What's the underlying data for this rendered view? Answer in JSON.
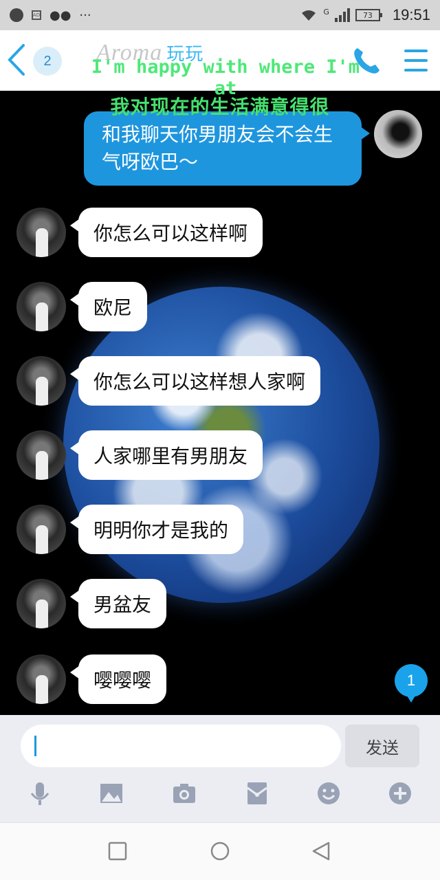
{
  "status_bar": {
    "time": "19:51",
    "battery": "73",
    "network": "G"
  },
  "header": {
    "unread_count": "2",
    "contact_name": "Aroma",
    "contact_suffix": "玩玩",
    "overlay_english": "I'm happy with where I'm at",
    "overlay_chinese": "我对现在的生活满意得很"
  },
  "messages": [
    {
      "direction": "out",
      "text": "和我聊天你男朋友会不会生气呀欧巴～"
    },
    {
      "direction": "in",
      "text": "你怎么可以这样啊"
    },
    {
      "direction": "in",
      "text": "欧尼"
    },
    {
      "direction": "in",
      "text": "你怎么可以这样想人家啊"
    },
    {
      "direction": "in",
      "text": "人家哪里有男朋友"
    },
    {
      "direction": "in",
      "text": "明明你才是我的"
    },
    {
      "direction": "in",
      "text": "男盆友"
    },
    {
      "direction": "in",
      "text": "嘤嘤嘤"
    }
  ],
  "new_message_badge": "1",
  "input": {
    "value": "",
    "send_label": "发送"
  },
  "toolbar": [
    "mic-icon",
    "image-icon",
    "camera-icon",
    "red-packet-icon",
    "emoji-icon",
    "plus-icon"
  ],
  "colors": {
    "accent": "#1e96de",
    "overlay_text": "#4ee878",
    "background": "#000000"
  }
}
